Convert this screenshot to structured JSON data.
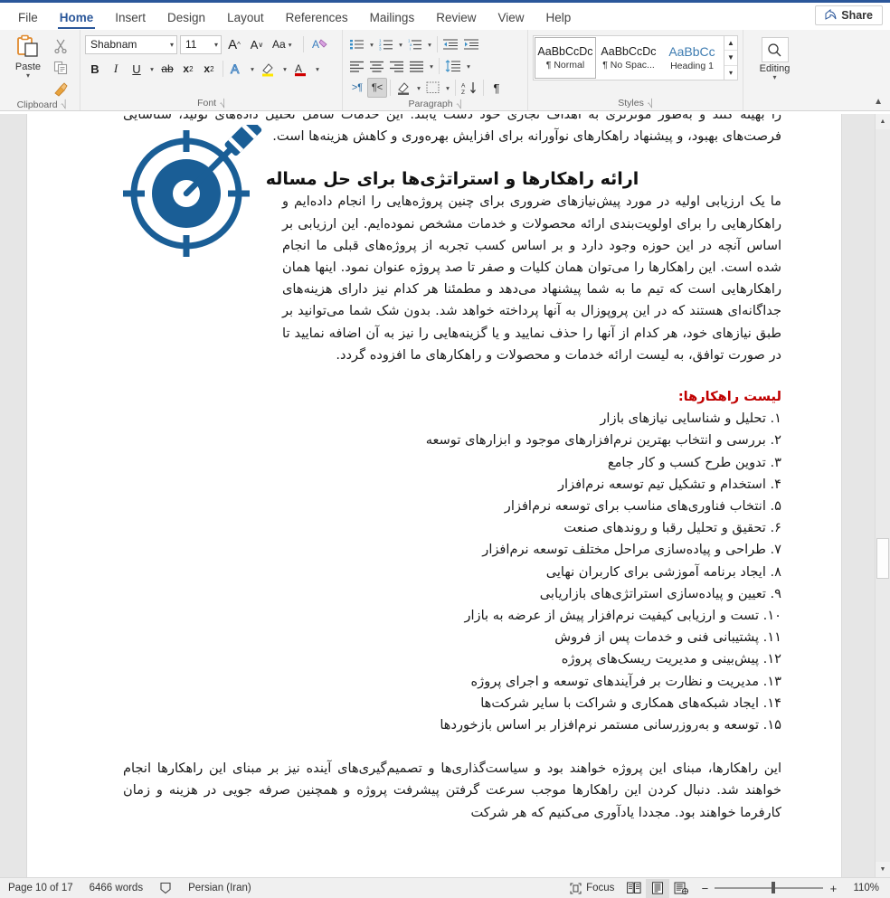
{
  "window": {
    "accent_color": "#2b579a"
  },
  "ribbon": {
    "tabs": [
      {
        "label": "File",
        "active": false
      },
      {
        "label": "Home",
        "active": true
      },
      {
        "label": "Insert",
        "active": false
      },
      {
        "label": "Design",
        "active": false
      },
      {
        "label": "Layout",
        "active": false
      },
      {
        "label": "References",
        "active": false
      },
      {
        "label": "Mailings",
        "active": false
      },
      {
        "label": "Review",
        "active": false
      },
      {
        "label": "View",
        "active": false
      },
      {
        "label": "Help",
        "active": false
      }
    ],
    "share_label": "Share",
    "groups": {
      "clipboard": {
        "label": "Clipboard",
        "paste_label": "Paste",
        "items": [
          "cut-icon",
          "copy-icon",
          "format-painter-icon"
        ]
      },
      "font": {
        "label": "Font",
        "font_name": "Shabnam",
        "font_size": "11",
        "buttons": [
          "grow-font",
          "shrink-font",
          "change-case",
          "clear-formatting",
          "bold",
          "italic",
          "underline",
          "strikethrough",
          "subscript",
          "superscript",
          "text-effects",
          "text-highlight",
          "font-color"
        ],
        "bold_label": "B",
        "italic_label": "I",
        "underline_label": "U",
        "strike_label": "ab",
        "subscript_label": "x",
        "superscript_label": "x",
        "case_label": "Aa",
        "grow_label": "A",
        "shrink_label": "A"
      },
      "paragraph": {
        "label": "Paragraph",
        "buttons": [
          "bullets",
          "numbering",
          "multilevel-list",
          "decrease-indent",
          "increase-indent",
          "align-left",
          "center",
          "align-right",
          "justify",
          "line-spacing",
          "ltr-text-direction",
          "rtl-text-direction",
          "shading",
          "borders",
          "sort",
          "show-formatting-marks"
        ],
        "ltr_label": ">¶",
        "rtl_label": "¶<",
        "pilcrow_label": "¶"
      },
      "styles": {
        "label": "Styles",
        "items": [
          {
            "preview": "AaBbCcDc",
            "name": "¶ Normal",
            "selected": true
          },
          {
            "preview": "AaBbCcDc",
            "name": "¶ No Spac...",
            "selected": false
          },
          {
            "preview": "AaBbCс",
            "name": "Heading 1",
            "selected": false
          }
        ]
      },
      "editing": {
        "label": "Editing",
        "icon": "search-icon"
      }
    }
  },
  "document": {
    "paragraph_top": "را بهینه کنند و به‌طور موثرتری به اهداف تجاری خود دست یابند. این خدمات شامل تحلیل داده‌های تولید، شناسایی فرصت‌های بهبود، و پیشنهاد راهکارهای نوآورانه برای افزایش بهره‌وری و کاهش هزینه‌ها است.",
    "heading": "ارائه راهکارها و استراتژی‌ها برای حل مساله",
    "image_alt": "target-dart-icon",
    "image_color": "#1a5e96",
    "paragraph_main": "ما یک ارزیابی اولیه در مورد پیش‌نیازهای ضروری برای چنین پروژه‌هایی را انجام داده‌ایم و راهکارهایی را برای اولویت‌بندی ارائه محصولات و خدمات مشخص نموده‌ایم. این ارزیابی بر اساس آنچه در این حوزه وجود دارد و بر اساس کسب تجربه از پروژه‌های قبلی ما انجام شده است. این راهکارها را می‌توان همان کلیات و صفر تا صد پروژه عنوان نمود. اینها همان راهکارهایی است که تیم ما به شما پیشنهاد می‌دهد و مطمئنا هر کدام نیز دارای هزینه‌های جداگانه‌ای هستند که در این پروپوزال به آنها پرداخته خواهد شد. بدون شک شما می‌توانید بر طبق نیازهای خود، هر کدام از آنها را حذف نمایید و یا گزینه‌هایی را نیز به آن اضافه نمایید تا در صورت توافق، به لیست ارائه خدمات و محصولات و راهکارهای ما افزوده گردد.",
    "list_heading": "لیست راهکارها:",
    "list_heading_color": "#c00000",
    "list_items": [
      "۱. تحلیل و شناسایی نیازهای بازار",
      "۲. بررسی و انتخاب بهترین نرم‌افزارهای موجود و ابزارهای توسعه",
      "۳. تدوین طرح کسب و کار جامع",
      "۴. استخدام و تشکیل تیم توسعه نرم‌افزار",
      "۵. انتخاب فناوری‌های مناسب برای توسعه نرم‌افزار",
      "۶. تحقیق و تحلیل رقبا و روندهای صنعت",
      "۷. طراحی و پیاده‌سازی مراحل مختلف توسعه نرم‌افزار",
      "۸. ایجاد برنامه آموزشی برای کاربران نهایی",
      "۹. تعیین و پیاده‌سازی استراتژی‌های بازاریابی",
      "۱۰. تست و ارزیابی کیفیت نرم‌افزار پیش از عرضه به بازار",
      "۱۱. پشتیبانی فنی و خدمات پس از فروش",
      "۱۲. پیش‌بینی و مدیریت ریسک‌های پروژه",
      "۱۳. مدیریت و نظارت بر فرآیندهای توسعه و اجرای پروژه",
      "۱۴. ایجاد شبکه‌های همکاری و شراکت با سایر شرکت‌ها",
      "۱۵. توسعه و به‌روزرسانی مستمر نرم‌افزار بر اساس بازخوردها"
    ],
    "paragraph_bottom": "این راهکارها، مبنای این پروژه خواهند بود و سیاست‌گذاری‌ها و تصمیم‌گیری‌های آینده نیز بر مبنای این راهکارها انجام خواهند شد. دنبال کردن این راهکارها موجب سرعت گرفتن پیشرفت پروژه و همچنین صرفه جویی در هزینه و زمان کارفرما خواهند بود. مجددا یادآوری می‌کنیم که هر شرکت"
  },
  "status_bar": {
    "page": "Page 10 of 17",
    "words": "6466 words",
    "proofing_icon": "proofing-errors-icon",
    "language": "Persian (Iran)",
    "focus_label": "Focus",
    "views": [
      {
        "name": "read-mode",
        "selected": false
      },
      {
        "name": "print-layout",
        "selected": true
      },
      {
        "name": "web-layout",
        "selected": false
      }
    ],
    "zoom_out_label": "−",
    "zoom_in_label": "+",
    "zoom_level": "110%"
  }
}
